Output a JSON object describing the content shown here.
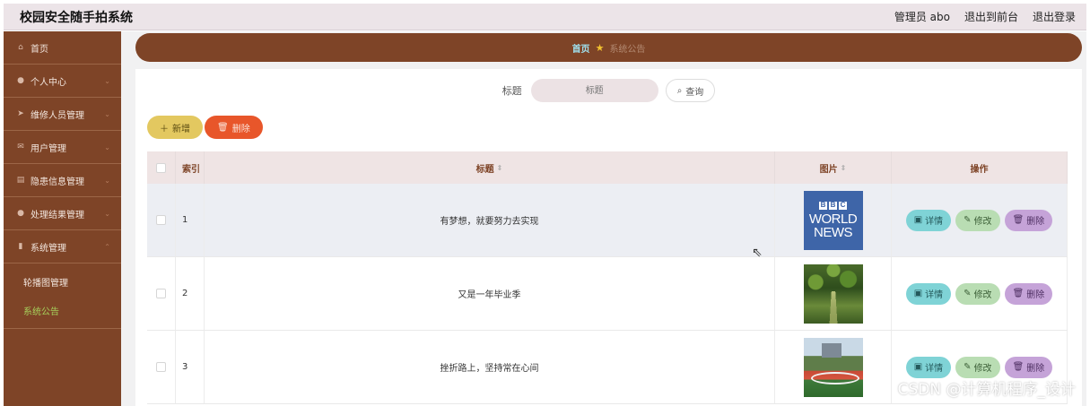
{
  "header": {
    "app_title": "校园安全随手拍系统",
    "admin_label": "管理员 abo",
    "front_link": "退出到前台",
    "logout_link": "退出登录"
  },
  "sidebar": {
    "items": [
      {
        "label": "首页",
        "icon": "home-icon",
        "has_chevron": false
      },
      {
        "label": "个人中心",
        "icon": "user-icon",
        "has_chevron": true
      },
      {
        "label": "维修人员管理",
        "icon": "send-icon",
        "has_chevron": true
      },
      {
        "label": "用户管理",
        "icon": "mail-icon",
        "has_chevron": true
      },
      {
        "label": "隐患信息管理",
        "icon": "document-icon",
        "has_chevron": true
      },
      {
        "label": "处理结果管理",
        "icon": "user-icon",
        "has_chevron": true
      },
      {
        "label": "系统管理",
        "icon": "chart-icon",
        "has_chevron": true
      }
    ],
    "sub_items": [
      {
        "label": "轮播图管理",
        "active": false
      },
      {
        "label": "系统公告",
        "active": true
      }
    ]
  },
  "breadcrumb": {
    "home": "首页",
    "current": "系统公告"
  },
  "search": {
    "label": "标题",
    "placeholder": "标题",
    "query_button": "查询"
  },
  "actions": {
    "add_label": "新增",
    "delete_label": "删除"
  },
  "table": {
    "columns": {
      "index": "索引",
      "title": "标题",
      "image": "图片",
      "ops": "操作"
    },
    "rows": [
      {
        "index": "1",
        "title": "有梦想，就要努力去实现",
        "image": "bbc-world-news-thumbnail"
      },
      {
        "index": "2",
        "title": "又是一年毕业季",
        "image": "forest-path-thumbnail"
      },
      {
        "index": "3",
        "title": "挫折路上，坚持常在心间",
        "image": "campus-track-thumbnail"
      }
    ],
    "op_labels": {
      "detail": "详情",
      "edit": "修改",
      "delete": "删除"
    }
  },
  "thumb_text": {
    "bbc_blocks": [
      "B",
      "B",
      "C"
    ],
    "line1": "WORLD",
    "line2": "NEWS"
  },
  "watermark": "CSDN @计算机程序_设计",
  "colors": {
    "sidebar_bg": "#7e4427",
    "breadcrumb_bg": "#7e4427",
    "active_sub": "#a6d15c",
    "add_button": "#e3c860",
    "delete_button": "#e8562a",
    "detail_button": "#7fd3d6",
    "edit_button": "#b9ddb3",
    "row_delete_button": "#c5a3d8"
  }
}
